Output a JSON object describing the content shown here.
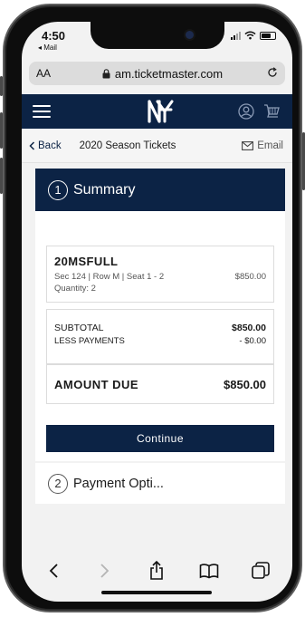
{
  "status_bar": {
    "time": "4:50",
    "back_app": "◂ Mail"
  },
  "browser": {
    "aa_label": "AA",
    "domain": "am.ticketmaster.com"
  },
  "subheader": {
    "back_label": "Back",
    "title": "2020 Season Tickets",
    "email_label": "Email"
  },
  "summary": {
    "step_number": "1",
    "title": "Summary",
    "item": {
      "code": "20MSFULL",
      "details": "Sec 124 | Row M  |  Seat 1 - 2",
      "price": "$850.00",
      "quantity": "Quantity: 2"
    },
    "totals": {
      "subtotal_label": "SUBTOTAL",
      "subtotal_value": "$850.00",
      "less_payments_label": "LESS PAYMENTS",
      "less_payments_value": "- $0.00"
    },
    "amount_due_label": "AMOUNT DUE",
    "amount_due_value": "$850.00",
    "continue_label": "Continue"
  },
  "payment": {
    "step_number": "2",
    "title": "Payment Opti..."
  },
  "colors": {
    "navy": "#0c2345",
    "background": "#f2f2f2"
  },
  "icons": {
    "navbar": [
      "hamburger-menu-icon",
      "yankees-logo",
      "account-icon",
      "cart-icon"
    ],
    "toolbar": [
      "back-arrow-icon",
      "forward-arrow-icon",
      "share-icon",
      "bookmarks-icon",
      "tabs-icon"
    ]
  }
}
